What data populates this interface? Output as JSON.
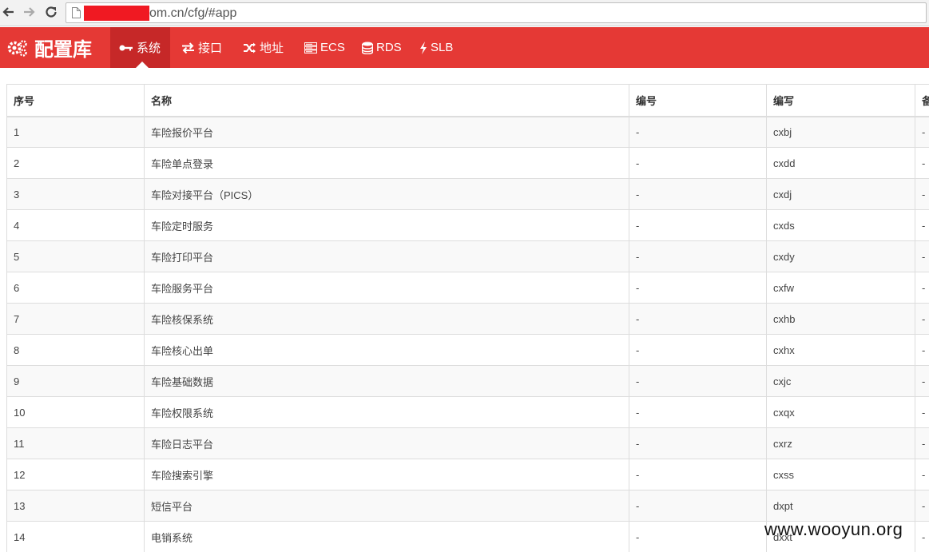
{
  "browser": {
    "url": "om.cn/cfg/#app"
  },
  "navbar": {
    "brand": "配置库",
    "items": [
      {
        "label": "系统",
        "icon": "key-icon",
        "active": true
      },
      {
        "label": "接口",
        "icon": "exchange-icon",
        "active": false
      },
      {
        "label": "地址",
        "icon": "random-icon",
        "active": false
      },
      {
        "label": "ECS",
        "icon": "server-icon",
        "active": false
      },
      {
        "label": "RDS",
        "icon": "database-icon",
        "active": false
      },
      {
        "label": "SLB",
        "icon": "bolt-icon",
        "active": false
      }
    ]
  },
  "table": {
    "columns": [
      "序号",
      "名称",
      "编号",
      "编写",
      "备"
    ],
    "rows": [
      [
        "1",
        "车险报价平台",
        "-",
        "cxbj",
        "-"
      ],
      [
        "2",
        "车险单点登录",
        "-",
        "cxdd",
        "-"
      ],
      [
        "3",
        "车险对接平台（PICS）",
        "-",
        "cxdj",
        "-"
      ],
      [
        "4",
        "车险定时服务",
        "-",
        "cxds",
        "-"
      ],
      [
        "5",
        "车险打印平台",
        "-",
        "cxdy",
        "-"
      ],
      [
        "6",
        "车险服务平台",
        "-",
        "cxfw",
        "-"
      ],
      [
        "7",
        "车险核保系统",
        "-",
        "cxhb",
        "-"
      ],
      [
        "8",
        "车险核心出单",
        "-",
        "cxhx",
        "-"
      ],
      [
        "9",
        "车险基础数据",
        "-",
        "cxjc",
        "-"
      ],
      [
        "10",
        "车险权限系统",
        "-",
        "cxqx",
        "-"
      ],
      [
        "11",
        "车险日志平台",
        "-",
        "cxrz",
        "-"
      ],
      [
        "12",
        "车险搜索引擎",
        "-",
        "cxss",
        "-"
      ],
      [
        "13",
        "短信平台",
        "-",
        "dxpt",
        "-"
      ],
      [
        "14",
        "电销系统",
        "-",
        "dxxt",
        "-"
      ]
    ]
  },
  "watermark": "www.wooyun.org",
  "colors": {
    "navbar": "#e53935",
    "navbar_active": "#c62828"
  }
}
